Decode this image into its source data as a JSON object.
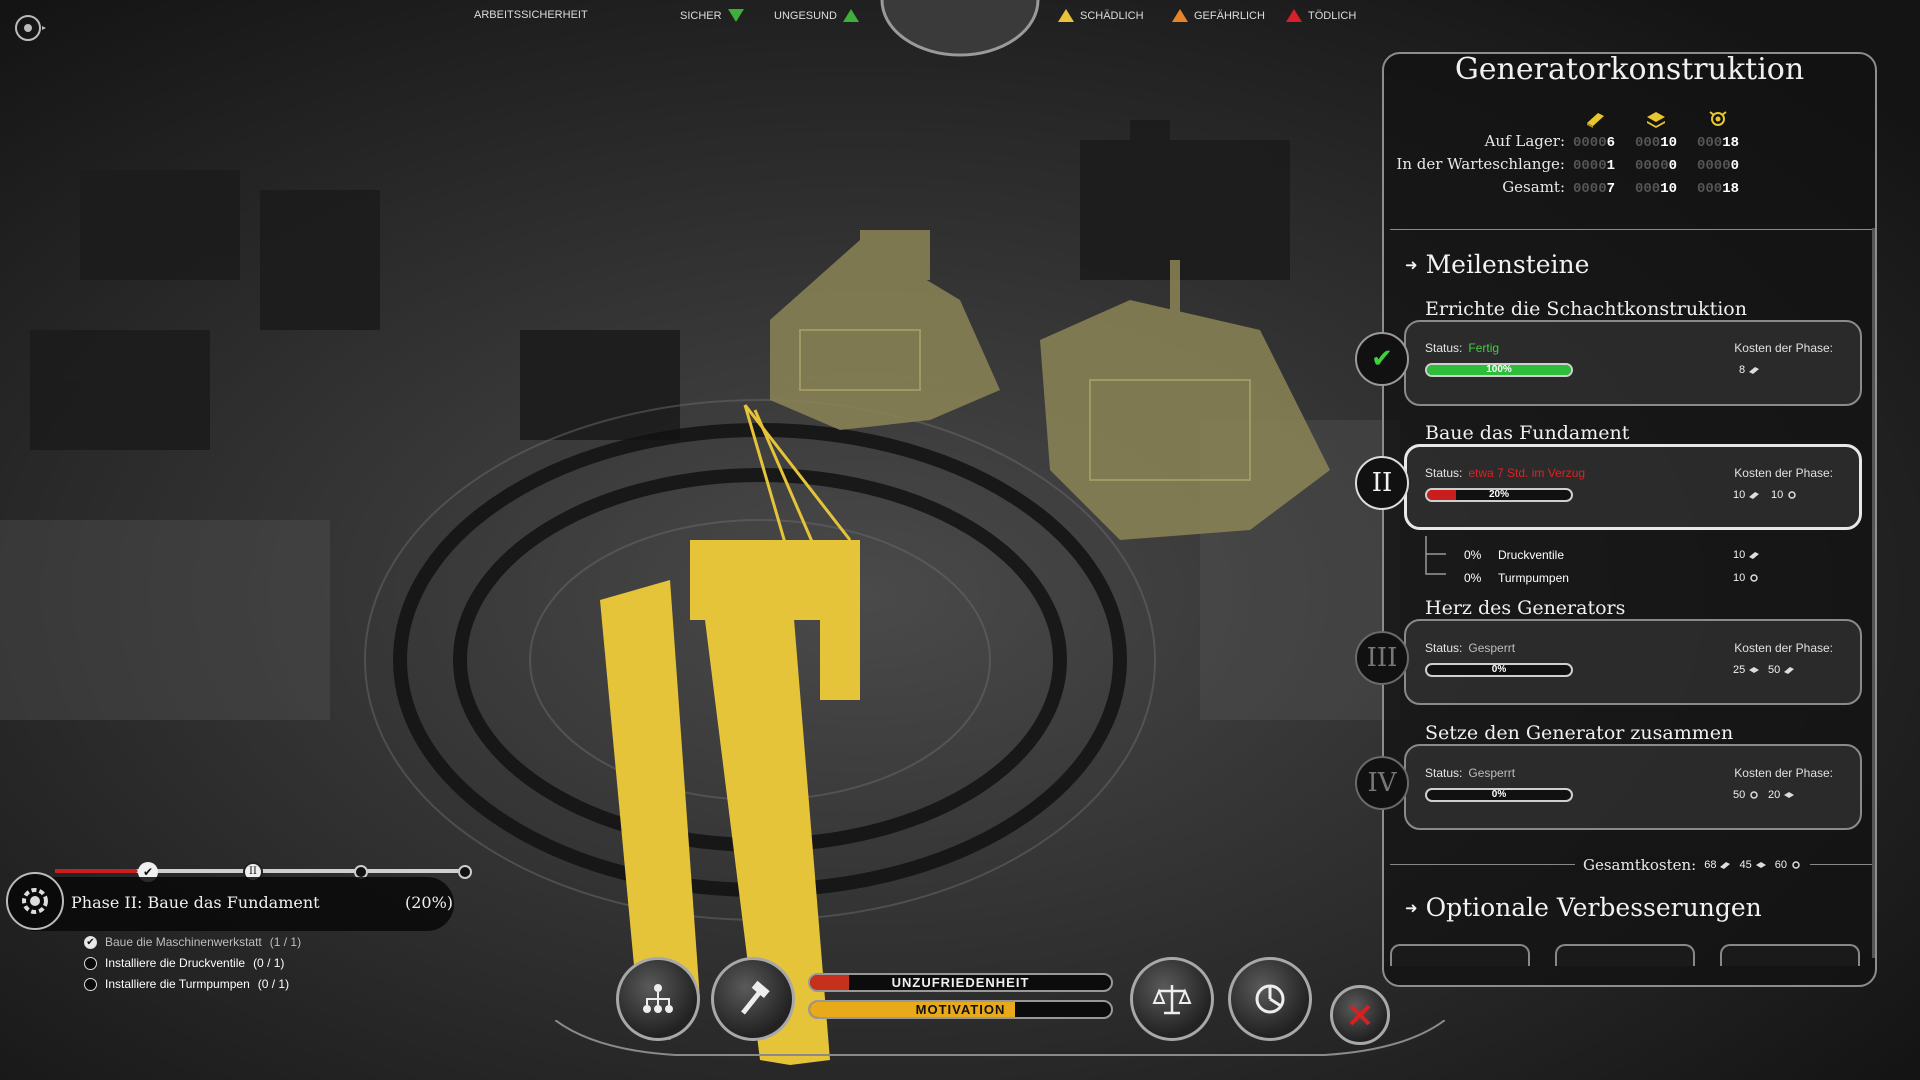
{
  "topbar": {
    "category_label": "ARBEITSSICHERHEIT",
    "levels": [
      {
        "label": "SICHER",
        "color": "#3fae3a",
        "icon": "triangle-down-icon"
      },
      {
        "label": "UNGESUND",
        "color": "#3fae3a",
        "icon": "triangle-up-icon"
      },
      {
        "label": "SCHÄDLICH",
        "color": "#e8c23a",
        "icon": "triangle-up-icon"
      },
      {
        "label": "GEFÄHRLICH",
        "color": "#e8832a",
        "icon": "triangle-up-icon"
      },
      {
        "label": "TÖDLICH",
        "color": "#d8202a",
        "icon": "triangle-up-icon"
      }
    ]
  },
  "panel": {
    "title": "Generatorkonstruktion",
    "resources": {
      "icons": [
        "steel-ingot-icon",
        "wood-stack-icon",
        "core-icon"
      ],
      "rows": [
        {
          "label": "Auf Lager:",
          "zeros": [
            "0000",
            "000",
            "000"
          ],
          "values": [
            "6",
            "10",
            "18"
          ]
        },
        {
          "label": "In der Warteschlange:",
          "zeros": [
            "0000",
            "0000",
            "0000"
          ],
          "values": [
            "1",
            "0",
            "0"
          ]
        },
        {
          "label": "Gesamt:",
          "zeros": [
            "0000",
            "000",
            "000"
          ],
          "values": [
            "7",
            "10",
            "18"
          ]
        }
      ]
    },
    "milestones_heading": "Meilensteine",
    "milestones": [
      {
        "title": "Errichte die Schachtkonstruktion",
        "badge": "✔",
        "status_label": "Status:",
        "status_value": "Fertig",
        "status_color": "#3fcf3f",
        "progress": 100,
        "progress_label": "100%",
        "bar_color": "#2ebd3a",
        "cost_label": "Kosten der Phase:",
        "costs": [
          {
            "amount": "8",
            "icon": "steel-ingot-icon"
          }
        ]
      },
      {
        "title": "Baue das Fundament",
        "badge": "II",
        "status_label": "Status:",
        "status_value": "etwa 7 Std. im Verzug",
        "status_color": "#e02020",
        "progress": 20,
        "progress_label": "20%",
        "bar_color": "#c81e1e",
        "cost_label": "Kosten der Phase:",
        "costs": [
          {
            "amount": "10",
            "icon": "steel-ingot-icon"
          },
          {
            "amount": "10",
            "icon": "core-icon"
          }
        ],
        "subtasks": [
          {
            "pct": "0%",
            "label": "Druckventile",
            "amount": "10",
            "icon": "steel-ingot-icon"
          },
          {
            "pct": "0%",
            "label": "Turmpumpen",
            "amount": "10",
            "icon": "core-icon"
          }
        ]
      },
      {
        "title": "Herz des Generators",
        "badge": "III",
        "status_label": "Status:",
        "status_value": "Gesperrt",
        "status_color": "#bdbdbd",
        "progress": 0,
        "progress_label": "0%",
        "bar_color": "#888",
        "cost_label": "Kosten der Phase:",
        "costs": [
          {
            "amount": "25",
            "icon": "wood-stack-icon"
          },
          {
            "amount": "50",
            "icon": "steel-ingot-icon"
          }
        ]
      },
      {
        "title": "Setze den Generator zusammen",
        "badge": "IV",
        "status_label": "Status:",
        "status_value": "Gesperrt",
        "status_color": "#bdbdbd",
        "progress": 0,
        "progress_label": "0%",
        "bar_color": "#888",
        "cost_label": "Kosten der Phase:",
        "costs": [
          {
            "amount": "50",
            "icon": "core-icon"
          },
          {
            "amount": "20",
            "icon": "wood-stack-icon"
          }
        ]
      }
    ],
    "total_label": "Gesamtkosten:",
    "totals": [
      {
        "amount": "68",
        "icon": "steel-ingot-icon"
      },
      {
        "amount": "45",
        "icon": "wood-stack-icon"
      },
      {
        "amount": "60",
        "icon": "core-icon"
      }
    ],
    "optional_heading": "Optionale Verbesserungen"
  },
  "phase": {
    "title": "Phase II: Baue das Fundament",
    "percent": "(20%)",
    "progress": 20,
    "tasks": [
      {
        "label": "Baue die Maschinenwerkstatt",
        "count": "(1 / 1)",
        "done": true
      },
      {
        "label": "Installiere die Druckventile",
        "count": "(0 / 1)",
        "done": false
      },
      {
        "label": "Installiere die Turmpumpen",
        "count": "(0 / 1)",
        "done": false
      }
    ]
  },
  "bottom": {
    "buttons": [
      "tech-tree-icon",
      "hammer-icon",
      "law-scales-icon",
      "pie-chart-icon",
      "close-icon"
    ],
    "discontent_label": "UNZUFRIEDENHEIT",
    "discontent_level": 0.13,
    "motivation_label": "MOTIVATION",
    "motivation_level": 0.68
  }
}
